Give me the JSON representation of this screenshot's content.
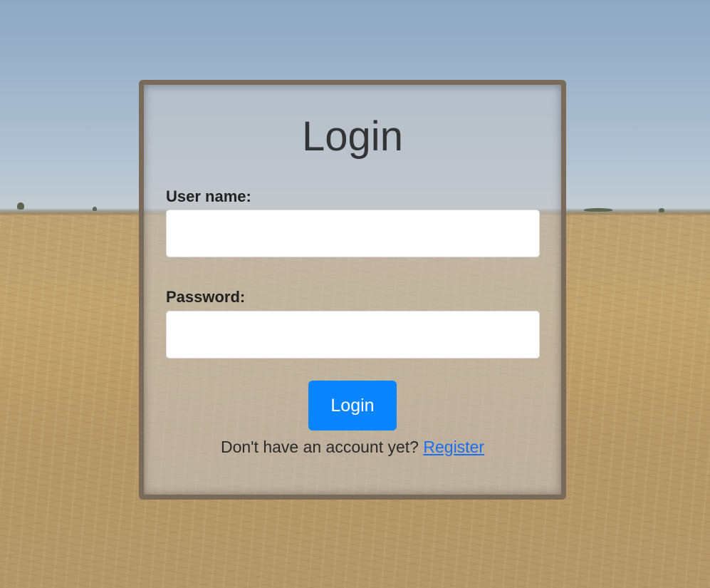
{
  "login_card": {
    "title": "Login",
    "username_label": "User name:",
    "username_value": "",
    "password_label": "Password:",
    "password_value": "",
    "submit_label": "Login",
    "register_prompt": "Don't have an account yet?",
    "register_link": "Register"
  },
  "colors": {
    "button_accent": "#0a84ff",
    "link": "#1a6ef0",
    "card_border": "#7a6a5a"
  }
}
